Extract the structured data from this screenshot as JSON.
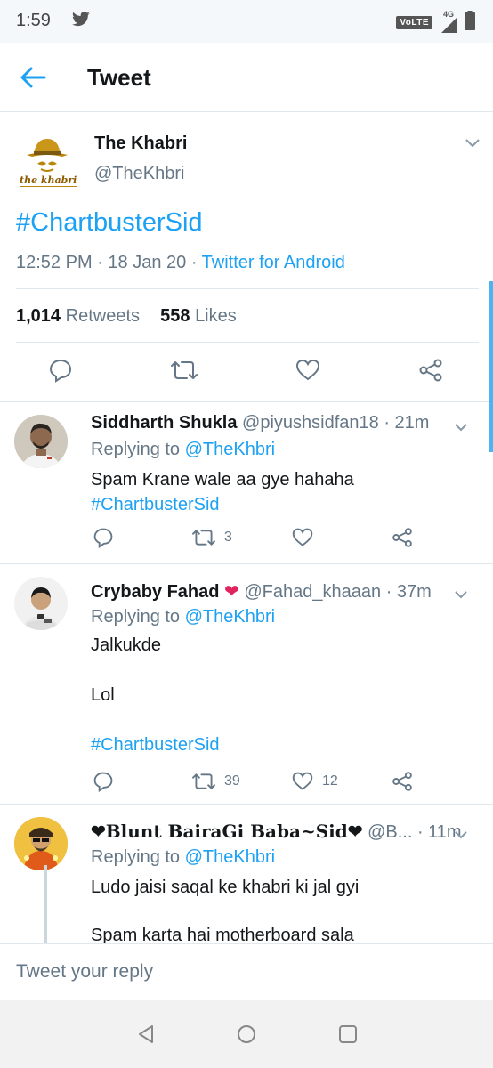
{
  "status_bar": {
    "time": "1:59",
    "volte": "VoLTE",
    "network": "4G"
  },
  "header": {
    "title": "Tweet"
  },
  "main_tweet": {
    "logo_text": "the khabri",
    "name": "The Khabri",
    "handle": "@TheKhbri",
    "text": "#ChartbusterSid",
    "time": "12:52 PM",
    "date": "18 Jan 20",
    "source": "Twitter for Android",
    "retweets_count": "1,014",
    "retweets_label": "Retweets",
    "likes_count": "558",
    "likes_label": "Likes"
  },
  "replies": [
    {
      "name": "Siddharth Shukla",
      "handle": "@piyushsidfan18",
      "time": "21m",
      "replying_prefix": "Replying to",
      "replying_to": "@TheKhbri",
      "text": "Spam Krane wale aa gye hahaha",
      "hashtag": "#ChartbusterSid",
      "retweets": "3",
      "likes": ""
    },
    {
      "name": "Crybaby Fahad",
      "name_emoji": "❤",
      "handle": "@Fahad_khaaan",
      "time": "37m",
      "replying_prefix": "Replying to",
      "replying_to": "@TheKhbri",
      "line1": "Jalkukde",
      "line2": "Lol",
      "hashtag": "#ChartbusterSid",
      "retweets": "39",
      "likes": "12"
    },
    {
      "name": "❤Blunt BairaGi Baba~Sid❤",
      "handle": "@B...",
      "time": "11m",
      "replying_prefix": "Replying to",
      "replying_to": "@TheKhbri",
      "line1": "Ludo jaisi saqal ke khabri ki jal gyi",
      "line2": "Spam karta hai motherboard sala"
    }
  ],
  "compose": {
    "placeholder": "Tweet your reply"
  },
  "colors": {
    "accent": "#1da1f2",
    "secondary_text": "#657786",
    "heart": "#e0245e"
  }
}
